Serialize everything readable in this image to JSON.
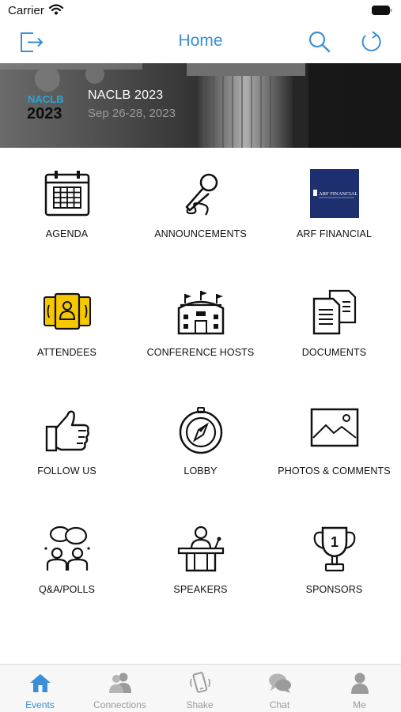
{
  "status_bar": {
    "carrier": "Carrier"
  },
  "nav": {
    "title": "Home",
    "accent_color": "#3a8fd6"
  },
  "banner": {
    "logo_text_top": "NACLB",
    "logo_text_bottom": "2023",
    "title": "NACLB 2023",
    "dates": "Sep 26-28, 2023"
  },
  "tiles": [
    {
      "label": "AGENDA",
      "icon": "calendar-icon"
    },
    {
      "label": "ANNOUNCEMENTS",
      "icon": "microphone-icon"
    },
    {
      "label": "ARF FINANCIAL",
      "icon": "arf-financial-logo",
      "logo_text": "ARF FINANCIAL"
    },
    {
      "label": "ATTENDEES",
      "icon": "badges-icon"
    },
    {
      "label": "CONFERENCE HOSTS",
      "icon": "building-icon"
    },
    {
      "label": "DOCUMENTS",
      "icon": "documents-icon"
    },
    {
      "label": "FOLLOW US",
      "icon": "thumbs-up-icon"
    },
    {
      "label": "LOBBY",
      "icon": "compass-icon"
    },
    {
      "label": "PHOTOS & COMMENTS",
      "icon": "photo-icon"
    },
    {
      "label": "Q&A/POLLS",
      "icon": "discussion-icon"
    },
    {
      "label": "SPEAKERS",
      "icon": "podium-icon"
    },
    {
      "label": "SPONSORS",
      "icon": "trophy-icon",
      "trophy_number": "1"
    }
  ],
  "tab_bar": {
    "active_color": "#3a8fd6",
    "items": [
      {
        "label": "Events",
        "icon": "house-icon",
        "active": true
      },
      {
        "label": "Connections",
        "icon": "people-icon",
        "active": false
      },
      {
        "label": "Shake",
        "icon": "shake-phone-icon",
        "active": false
      },
      {
        "label": "Chat",
        "icon": "chat-bubbles-icon",
        "active": false
      },
      {
        "label": "Me",
        "icon": "person-icon",
        "active": false
      }
    ]
  }
}
